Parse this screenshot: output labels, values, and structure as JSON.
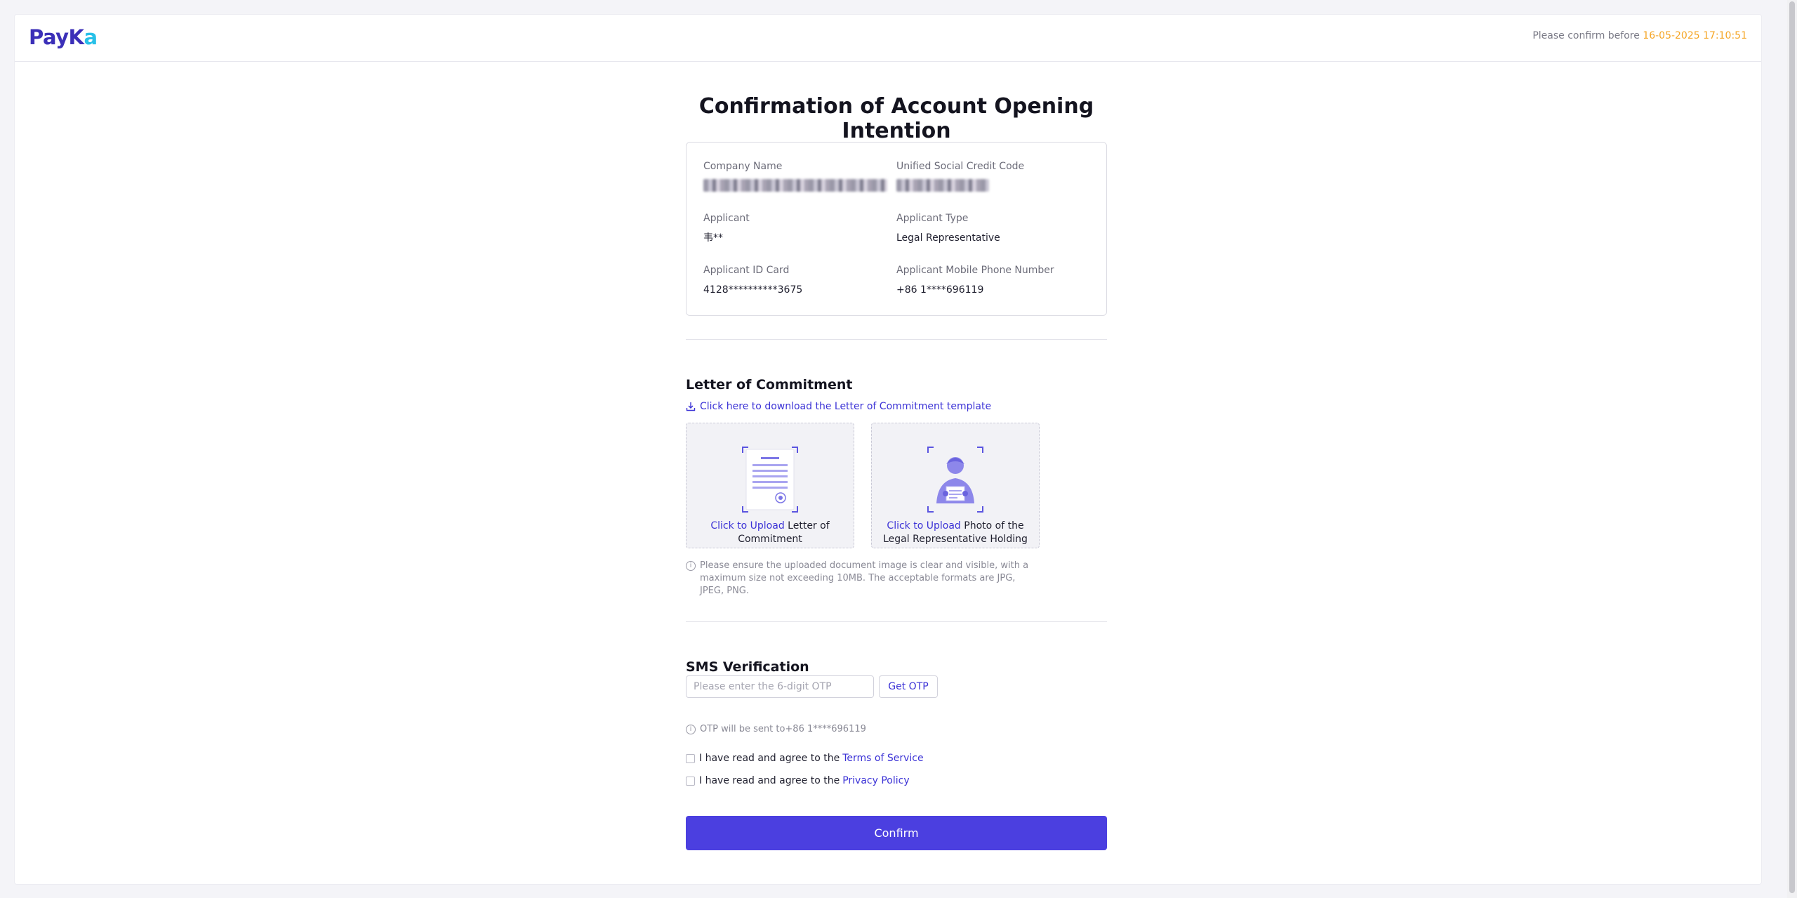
{
  "header": {
    "logo_part1": "PayK",
    "logo_part2": "a",
    "deadline_prefix": "Please confirm before ",
    "deadline_time": "16-05-2025 17:10:51"
  },
  "page": {
    "title": "Confirmation of Account Opening Intention"
  },
  "info": {
    "company_name_label": "Company Name",
    "credit_code_label": "Unified Social Credit Code",
    "applicant_label": "Applicant",
    "applicant_value": "韦**",
    "applicant_type_label": "Applicant Type",
    "applicant_type_value": "Legal Representative",
    "id_card_label": "Applicant ID Card",
    "id_card_value": "4128**********3675",
    "mobile_label": "Applicant Mobile Phone Number",
    "mobile_value": "+86 1****696119"
  },
  "commitment": {
    "title": "Letter of Commitment",
    "download_link": "Click here to download the Letter of Commitment template",
    "upload1_link": "Click to Upload",
    "upload1_text": " Letter of Commitment",
    "upload2_link": "Click to Upload",
    "upload2_text": " Photo of the Legal Representative Holding",
    "note": "Please ensure the uploaded document image is clear and visible, with a maximum size not exceeding 10MB. The acceptable formats are JPG, JPEG, PNG."
  },
  "sms": {
    "title": "SMS Verification",
    "otp_placeholder": "Please enter the 6-digit OTP",
    "otp_value": "",
    "get_otp_label": "Get OTP",
    "otp_note": "OTP will be sent to+86 1****696119"
  },
  "agreements": {
    "terms_prefix": "I have read and agree to the",
    "terms_link": "Terms of Service",
    "privacy_prefix": "I have read and agree to the",
    "privacy_link": "Privacy Policy"
  },
  "confirm_label": "Confirm",
  "colors": {
    "primary": "#4b3fe0",
    "link": "#3c33d6",
    "deadline_time": "#f5a524",
    "logo_primary": "#3b2fb8",
    "logo_accent": "#27c0e8"
  },
  "icons": {
    "download": "download-icon",
    "document_upload": "document-illustration-icon",
    "person_upload": "person-holding-document-icon",
    "info": "info-icon"
  }
}
